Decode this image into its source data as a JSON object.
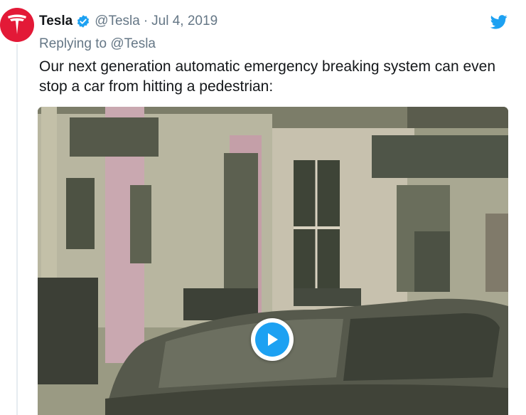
{
  "tweet": {
    "author_name": "Tesla",
    "handle": "@Tesla",
    "separator": "·",
    "date": "Jul 4, 2019",
    "replying_prefix": "Replying to",
    "replying_to": "@Tesla",
    "text": "Our next generation automatic emergency breaking system can even stop a car from hitting a pedestrian:"
  },
  "icons": {
    "avatar": "tesla-logo-icon",
    "verified": "verified-badge-icon",
    "brand": "twitter-bird-icon",
    "play": "play-icon"
  },
  "colors": {
    "avatar_bg": "#e31937",
    "twitter_blue": "#1da1f2",
    "muted_text": "#657786"
  }
}
